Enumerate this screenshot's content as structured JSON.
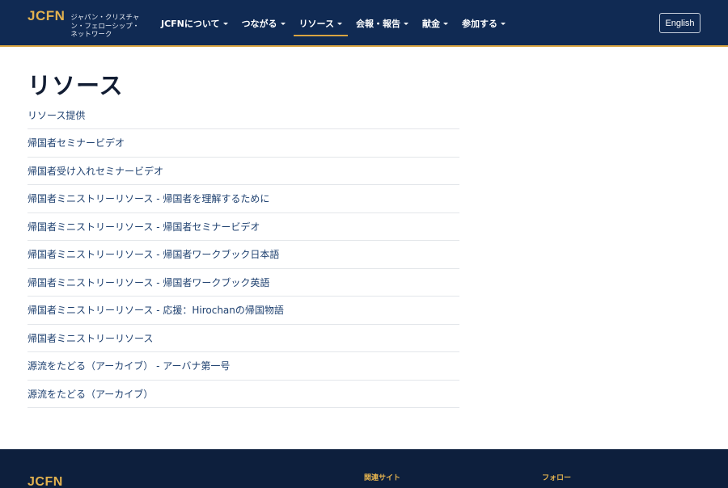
{
  "header": {
    "brand_logo": "JCFN",
    "brand_subtitle": "ジャパン・クリスチャン・フェローシップ・ネットワーク",
    "nav": [
      {
        "label": "JCFNについて"
      },
      {
        "label": "つながる"
      },
      {
        "label": "リソース",
        "active": true
      },
      {
        "label": "会報・報告"
      },
      {
        "label": "献金"
      },
      {
        "label": "参加する"
      }
    ],
    "language_button": "English"
  },
  "main": {
    "title": "リソース",
    "items": [
      "リソース提供",
      "帰国者セミナービデオ",
      "帰国者受け入れセミナービデオ",
      "帰国者ミニストリーリソース - 帰国者を理解するために",
      "帰国者ミニストリーリソース - 帰国者セミナービデオ",
      "帰国者ミニストリーリソース - 帰国者ワークブック日本語",
      "帰国者ミニストリーリソース - 帰国者ワークブック英語",
      "帰国者ミニストリーリソース - 応援：Hirochanの帰国物語",
      "帰国者ミニストリーリソース",
      "源流をたどる（アーカイブ） - アーバナ第一号",
      "源流をたどる（アーカイブ）"
    ]
  },
  "footer": {
    "logo": "JCFN",
    "related_heading": "関連サイト",
    "follow_heading": "フォロー"
  },
  "colors": {
    "header_bg": "#102a53",
    "accent_gold": "#d9a441",
    "link": "#1f4170",
    "footer_bg": "#0d1f3d"
  }
}
